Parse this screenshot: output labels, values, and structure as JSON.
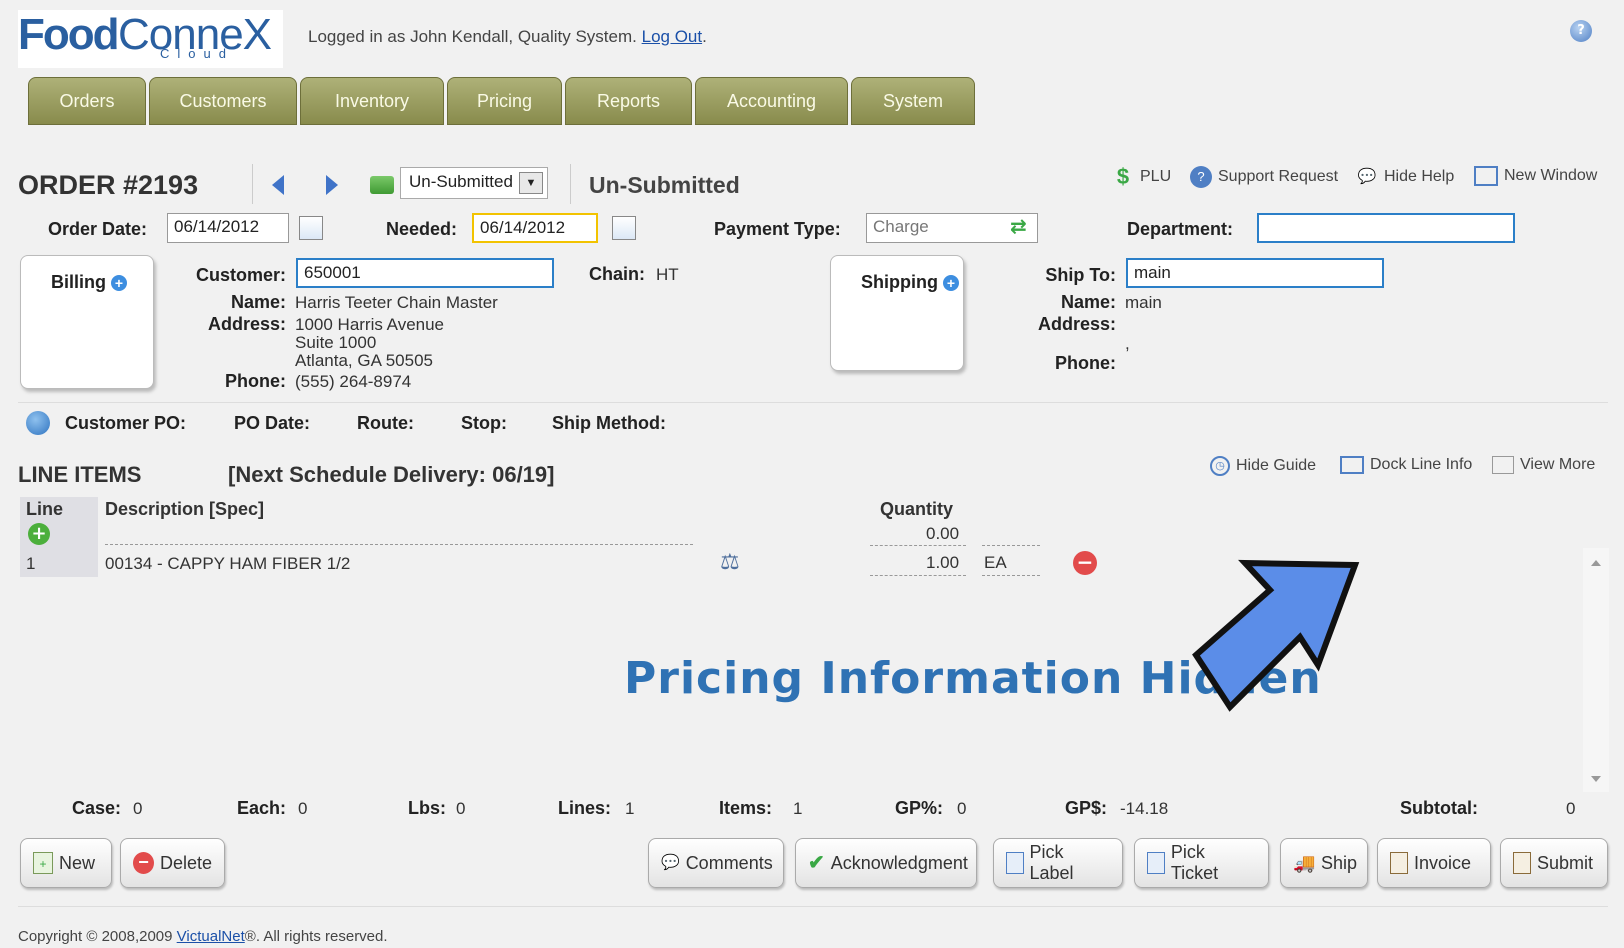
{
  "logo": {
    "food": "Food",
    "connex": "ConneX",
    "cloud": "Cloud"
  },
  "header": {
    "logged_in": "Logged in as John Kendall, Quality System.",
    "logout": "Log Out",
    "logout_suffix": "."
  },
  "nav": {
    "tabs": [
      "Orders",
      "Customers",
      "Inventory",
      "Pricing",
      "Reports",
      "Accounting",
      "System"
    ]
  },
  "order": {
    "title": "ORDER #2193",
    "status_select": "Un-Submitted",
    "status_text": "Un-Submitted",
    "order_date_label": "Order Date:",
    "order_date": "06/14/2012",
    "needed_label": "Needed:",
    "needed": "06/14/2012",
    "payment_type_label": "Payment Type:",
    "payment_type": "Charge",
    "department_label": "Department:",
    "department": ""
  },
  "toolbar": {
    "plu": "PLU",
    "support": "Support Request",
    "hide_help": "Hide Help",
    "new_window": "New Window"
  },
  "billing": {
    "card_label": "Billing",
    "customer_label": "Customer:",
    "customer": "650001",
    "chain_label": "Chain:",
    "chain": "HT",
    "name_label": "Name:",
    "name": "Harris Teeter Chain Master",
    "address_label": "Address:",
    "address_1": "1000 Harris Avenue",
    "address_2": "Suite 1000",
    "address_3": "Atlanta, GA 50505",
    "phone_label": "Phone:",
    "phone": "(555) 264-8974"
  },
  "shipping": {
    "card_label": "Shipping",
    "ship_to_label": "Ship To:",
    "ship_to": "main",
    "name_label": "Name:",
    "name": "main",
    "address_label": "Address:",
    "address": ",",
    "phone_label": "Phone:"
  },
  "po": {
    "customer_po": "Customer PO:",
    "po_date": "PO Date:",
    "route": "Route:",
    "stop": "Stop:",
    "ship_method": "Ship Method:"
  },
  "line_items": {
    "title": "LINE ITEMS",
    "next_delivery": "[Next Schedule Delivery: 06/19]",
    "hide_guide": "Hide Guide",
    "dock_line_info": "Dock Line Info",
    "view_more": "View More",
    "col_line": "Line",
    "col_description": "Description [Spec]",
    "col_quantity": "Quantity",
    "guide_qty": "0.00",
    "rows": [
      {
        "line": "1",
        "description": "00134 - CAPPY HAM FIBER 1/2",
        "quantity": "1.00",
        "uom": "EA"
      }
    ],
    "notice": "Pricing Information Hidden"
  },
  "totals": {
    "case_label": "Case:",
    "case": "0",
    "each_label": "Each:",
    "each": "0",
    "lbs_label": "Lbs:",
    "lbs": "0",
    "lines_label": "Lines:",
    "lines": "1",
    "items_label": "Items:",
    "items": "1",
    "gp_pct_label": "GP%:",
    "gp_pct": "0",
    "gp_dollar_label": "GP$:",
    "gp_dollar": "-14.18",
    "subtotal_label": "Subtotal:",
    "subtotal": "0"
  },
  "buttons": {
    "new": "New",
    "delete": "Delete",
    "comments": "Comments",
    "acknowledgment": "Acknowledgment",
    "pick_label": "Pick Label",
    "pick_ticket": "Pick Ticket",
    "ship": "Ship",
    "invoice": "Invoice",
    "submit": "Submit"
  },
  "footer": {
    "copyright": "Copyright © 2008,2009",
    "company": "VictualNet",
    "suffix": "®. All rights reserved."
  },
  "colors": {
    "tab": "#9a9d5e",
    "accent": "#2b7fc8",
    "notice": "#2f72b4",
    "arrow": "#5b8de8"
  }
}
